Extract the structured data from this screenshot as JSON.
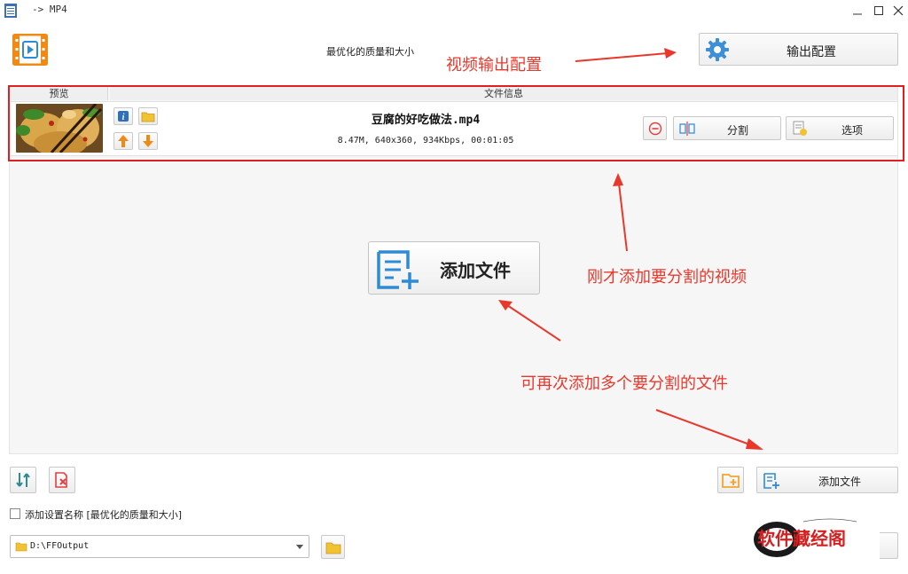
{
  "window": {
    "title": "-> MP4",
    "minimize_icon": "minimize-icon",
    "maximize_icon": "maximize-icon",
    "close_icon": "close-icon"
  },
  "header": {
    "quality_label": "最优化的质量和大小",
    "output_config_label": "输出配置"
  },
  "list": {
    "columns": [
      "预览",
      "文件信息"
    ],
    "rows": [
      {
        "file_name": "豆腐的好吃做法.mp4",
        "meta": "8.47M, 640x360, 934Kbps, 00:01:05",
        "split_label": "分割",
        "options_label": "选项"
      }
    ]
  },
  "center": {
    "add_file_label": "添加文件"
  },
  "annotations": {
    "output_config": "视频输出配置",
    "added_video": "刚才添加要分割的视频",
    "add_more": "可再次添加多个要分割的文件"
  },
  "bottom": {
    "add_file_label": "添加文件",
    "add_setting_name_label": "添加设置名称 [最优化的质量和大小]",
    "output_path": "D:\\FFOutput"
  },
  "watermark": {
    "text": "软件藏经阁"
  },
  "colors": {
    "accent_blue": "#2e8bd6",
    "annotation_red": "#e8382c",
    "folder_yellow": "#f1c232",
    "orange_arrow": "#f08a16"
  }
}
